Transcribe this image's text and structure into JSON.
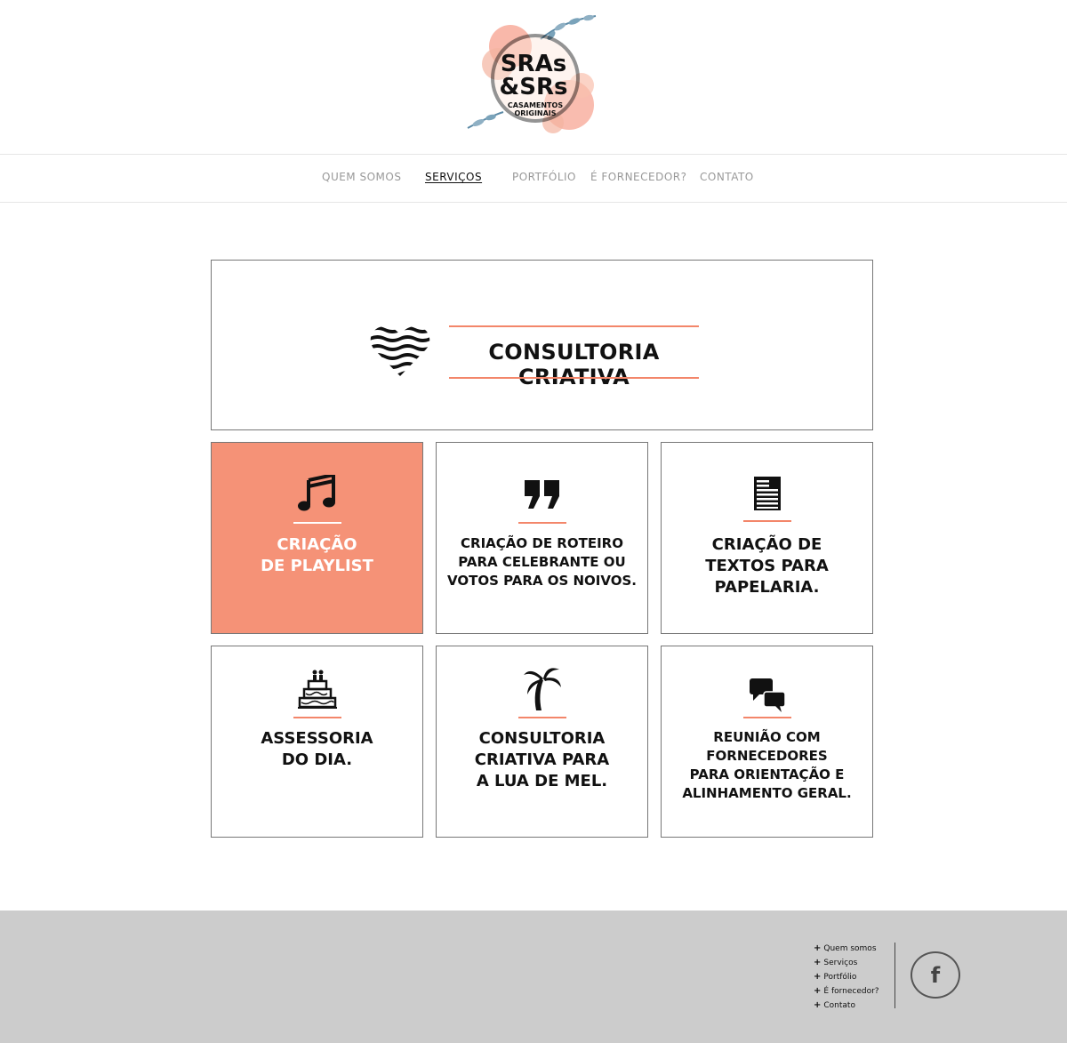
{
  "logo": {
    "line1": "SRAs",
    "line2": "&SRs",
    "line3": "CASAMENTOS",
    "line4": "ORIGINAIS"
  },
  "nav": {
    "items": [
      {
        "label": "QUEM SOMOS"
      },
      {
        "label": "SERVIÇOS"
      },
      {
        "label": "PORTFÓLIO"
      },
      {
        "label": "É FORNECEDOR?"
      },
      {
        "label": "CONTATO"
      }
    ],
    "active_index": 1
  },
  "hero": {
    "icon": "striped-heart-icon",
    "title": "CONSULTORIA CRIATIVA"
  },
  "cards": [
    {
      "icon": "music-note-icon",
      "text": "CRIAÇÃO\nDE PLAYLIST"
    },
    {
      "icon": "quote-icon",
      "text": "CRIAÇÃO DE ROTEIRO\nPARA CELEBRANTE OU\nVOTOS PARA OS NOIVOS."
    },
    {
      "icon": "document-icon",
      "text": "CRIAÇÃO DE\nTEXTOS PARA\nPAPELARIA."
    },
    {
      "icon": "wedding-cake-icon",
      "text": "ASSESSORIA\nDO DIA."
    },
    {
      "icon": "palm-tree-icon",
      "text": "CONSULTORIA\nCRIATIVA PARA\nA LUA DE MEL."
    },
    {
      "icon": "chat-bubbles-icon",
      "text": "REUNIÃO COM\nFORNECEDORES\nPARA ORIENTAÇÃO E\nALINHAMENTO GERAL."
    }
  ],
  "footer": {
    "links": [
      {
        "label": "Quem somos"
      },
      {
        "label": "Serviços"
      },
      {
        "label": "Portfólio"
      },
      {
        "label": "É fornecedor?"
      },
      {
        "label": "Contato"
      }
    ],
    "facebook_glyph": "f"
  },
  "colors": {
    "accent": "#f3866a",
    "card_highlight": "#f59277",
    "footer_bg": "#cccccc"
  }
}
